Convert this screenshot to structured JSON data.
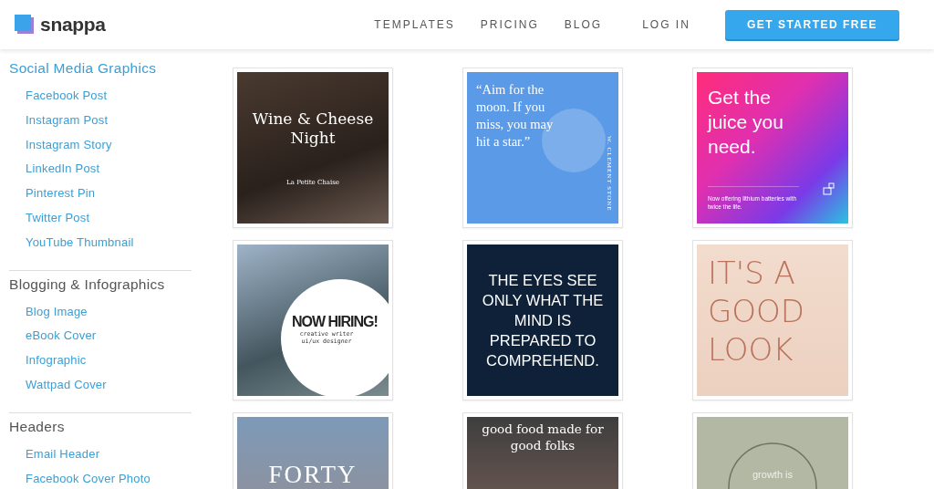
{
  "header": {
    "logo": "snappa",
    "nav": [
      "TEMPLATES",
      "PRICING",
      "BLOG"
    ],
    "login": "LOG IN",
    "cta": "GET STARTED FREE"
  },
  "sidebar": {
    "sections": [
      {
        "title": "Social Media Graphics",
        "selected": true,
        "items": [
          "Facebook Post",
          "Instagram Post",
          "Instagram Story",
          "LinkedIn Post",
          "Pinterest Pin",
          "Twitter Post",
          "YouTube Thumbnail"
        ]
      },
      {
        "title": "Blogging & Infographics",
        "selected": false,
        "items": [
          "Blog Image",
          "eBook Cover",
          "Infographic",
          "Wattpad Cover"
        ]
      },
      {
        "title": "Headers",
        "selected": false,
        "items": [
          "Email Header",
          "Facebook Cover Photo"
        ]
      }
    ]
  },
  "templates": [
    {
      "kind": "wine",
      "texts": [
        "Wine & Cheese Night",
        "La Petite Chaise"
      ]
    },
    {
      "kind": "moon",
      "texts": [
        "“Aim for the moon. If you miss, you may hit a star.”",
        "W. CLEMENT STONE"
      ]
    },
    {
      "kind": "gradient",
      "texts": [
        "Get the juice you need.",
        "Now offering lithium batteries with twice the life."
      ]
    },
    {
      "kind": "hiring",
      "texts": [
        "NOW HIRING!",
        "creative writer ui/ux designer"
      ]
    },
    {
      "kind": "dark",
      "texts": [
        "THE EYES SEE ONLY WHAT THE MIND IS PREPARED TO COMPREHEND."
      ]
    },
    {
      "kind": "pastel",
      "texts": [
        "IT'S A GOOD LOOK"
      ]
    },
    {
      "kind": "forty",
      "texts": [
        "FORTY"
      ]
    },
    {
      "kind": "food",
      "texts": [
        "good food made for good folks"
      ]
    },
    {
      "kind": "wreath",
      "texts": [
        "growth is"
      ]
    }
  ]
}
